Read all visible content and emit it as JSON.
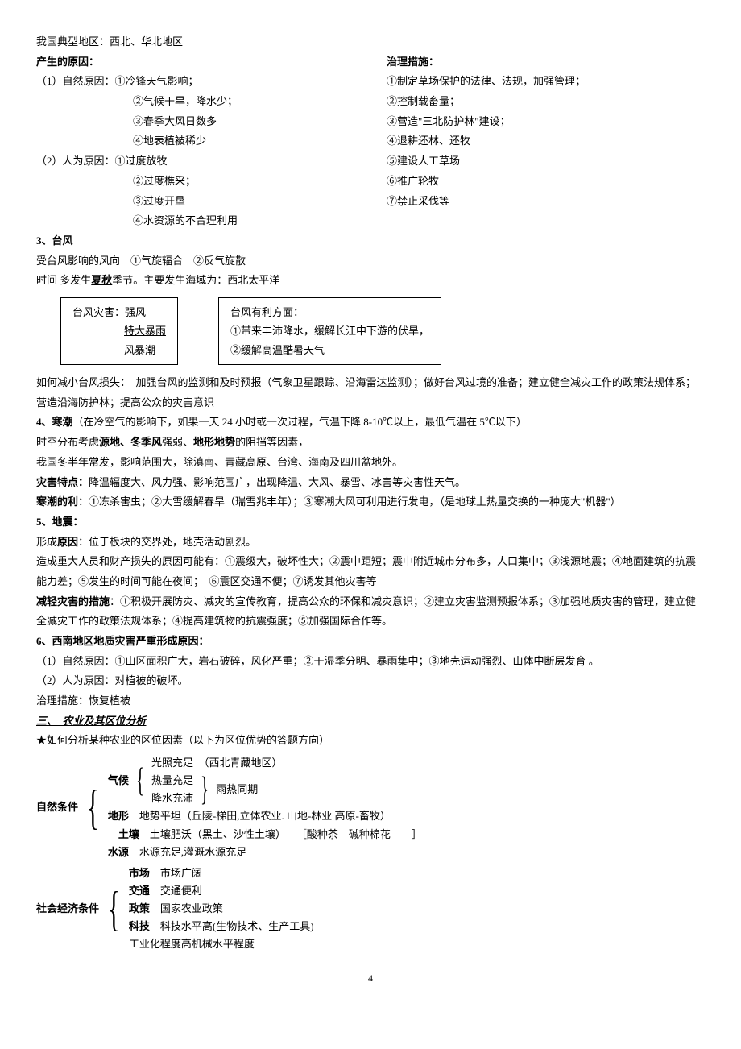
{
  "intro": "我国典型地区：西北、华北地区",
  "causes": {
    "title": "产生的原因：",
    "natural": {
      "label": "（1）自然原因：",
      "items": [
        "①冷锋天气影响；",
        "②气候干旱，降水少；",
        "③春季大风日数多",
        "④地表植被稀少"
      ]
    },
    "human": {
      "label": "（2）人为原因：",
      "items": [
        "①过度放牧",
        "②过度樵采；",
        "③过度开垦",
        "④水资源的不合理利用"
      ]
    }
  },
  "measures": {
    "title": "治理措施：",
    "items": [
      "①制定草场保护的法律、法规，加强管理；",
      "②控制载畜量；",
      "③营造\"三北防护林\"建设；",
      "④退耕还林、还牧",
      "⑤建设人工草场",
      "⑥推广轮牧",
      "⑦禁止采伐等"
    ]
  },
  "s3": {
    "title": "3、台风",
    "l1a": "受台风影响的风向　①气旋辐合　②反气旋散",
    "l2a": "时间 多发生",
    "l2b": "夏秋",
    "l2c": "季节。主要发生海域为：西北太平洋",
    "box1": {
      "a": "台风灾害：",
      "b": "强风",
      "c": "特大暴雨",
      "d": "风暴潮"
    },
    "box2": {
      "a": "台风有利方面：",
      "b": "①带来丰沛降水，缓解长江中下游的伏旱，",
      "c": "②缓解高温酷暑天气"
    },
    "reduce": "如何减小台风损失：　加强台风的监测和及时预报（气象卫星跟踪、沿海雷达监测）；做好台风过境的准备；建立健全减灾工作的政策法规体系；营造沿海防护林；提高公众的灾害意识"
  },
  "s4": {
    "title_a": "4、寒潮",
    "title_b": "（在冷空气的影响下，如果一天 24 小时或一次过程，气温下降 8-10℃以上，最低气温在 5℃以下）",
    "l1a": "时空分布考虑",
    "l1b": "源地、冬季风",
    "l1c": "强弱、",
    "l1d": "地形地势",
    "l1e": "的阻挡等因素，",
    "l2": "我国冬半年常发，影响范围大，除滇南、青藏高原、台湾、海南及四川盆地外。",
    "l3a": "灾害特点：",
    "l3b": "降温辐度大、风力强、影响范围广，出现降温、大风、暴雪、冰害等灾害性天气。",
    "l4a": "寒潮的利",
    "l4b": "：①冻杀害虫；②大雪缓解春旱（瑞雪兆丰年）；③寒潮大风可利用进行发电，（是地球上热量交换的一种庞大\"机器\"）"
  },
  "s5": {
    "title": "5、地震：",
    "l1a": "形成",
    "l1b": "原因",
    "l1c": "：位于板块的交界处，地壳活动剧烈。",
    "l2": "造成重大人员和财产损失的原因可能有：①震级大，破坏性大；②震中距短；震中附近城市分布多，人口集中；③浅源地震；④地面建筑的抗震能力差；⑤发生的时间可能在夜间；　⑥震区交通不便；⑦诱发其他灾害等",
    "l3a": "减轻灾害的措施",
    "l3b": "：①积极开展防灾、减灾的宣传教育，提高公众的环保和减灾意识；②建立灾害监测预报体系；③加强地质灾害的管理，建立健全减灾工作的政策法规体系；④提高建筑物的抗震强度；⑤加强国际合作等。"
  },
  "s6": {
    "title": "6、西南地区地质灾害严重形成原因：",
    "l1": "（1）自然原因：①山区面积广大，岩石破碎，风化严重；②干湿季分明、暴雨集中；③地壳运动强烈、山体中断层发育 。",
    "l2": "（2）人为原因：对植被的破坏。",
    "l3": "治理措施：恢复植被"
  },
  "s7": {
    "title": "三、　农业及其区位分析",
    "star": "★如何分析某种农业的区位因素（以下为区位优势的答题方向）",
    "natural_label": "自然条件",
    "climate_label": "气候",
    "climate": {
      "a": "光照充足　（西北青藏地区）",
      "b": "热量充足",
      "c": "降水充沛",
      "together": "雨热同期"
    },
    "terrain_label": "地形",
    "terrain": "地势平坦（丘陵-梯田,立体农业. 山地-林业 高原-畜牧）",
    "soil_label": "土壤",
    "soil": "土壤肥沃（黑土、沙性土壤）　　［酸种茶　碱种棉花　　］",
    "water_label": "水源",
    "water": "水源充足,灌溉水源充足",
    "social_label": "社会经济条件",
    "social": {
      "a_label": "市场",
      "a": "市场广阔",
      "b_label": "交通",
      "b": "交通便利",
      "c_label": "政策",
      "c": "国家农业政策",
      "d_label": "科技",
      "d": "科技水平高(生物技术、生产工具)",
      "e": "工业化程度高机械水平程度"
    }
  },
  "page": "4"
}
